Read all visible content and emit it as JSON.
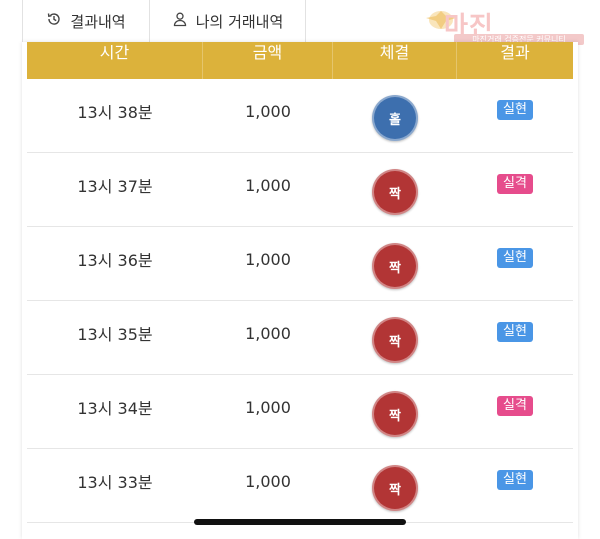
{
  "tabs": [
    {
      "label": "결과내역",
      "icon": "history-icon"
    },
    {
      "label": "나의 거래내역",
      "icon": "user-icon"
    }
  ],
  "watermark": {
    "title": "마진",
    "sub": "마진거래 검증전문 커뮤니티"
  },
  "table": {
    "headers": [
      "시간",
      "금액",
      "체결",
      "결과"
    ],
    "rows": [
      {
        "time": "13시 38분",
        "amount": "1,000",
        "fill": "홀",
        "fill_color": "#3d6fae",
        "result": "실현",
        "result_color": "#4a96e6"
      },
      {
        "time": "13시 37분",
        "amount": "1,000",
        "fill": "짝",
        "fill_color": "#b23535",
        "result": "실격",
        "result_color": "#e64c8c"
      },
      {
        "time": "13시 36분",
        "amount": "1,000",
        "fill": "짝",
        "fill_color": "#b23535",
        "result": "실현",
        "result_color": "#4a96e6"
      },
      {
        "time": "13시 35분",
        "amount": "1,000",
        "fill": "짝",
        "fill_color": "#b23535",
        "result": "실현",
        "result_color": "#4a96e6"
      },
      {
        "time": "13시 34분",
        "amount": "1,000",
        "fill": "짝",
        "fill_color": "#b23535",
        "result": "실격",
        "result_color": "#e64c8c"
      },
      {
        "time": "13시 33분",
        "amount": "1,000",
        "fill": "짝",
        "fill_color": "#b23535",
        "result": "실현",
        "result_color": "#4a96e6"
      }
    ]
  },
  "colors": {
    "header_bg": "#dcb23b",
    "odd": "#3d6fae",
    "even": "#b23535",
    "realized": "#4a96e6",
    "failed": "#e64c8c"
  }
}
